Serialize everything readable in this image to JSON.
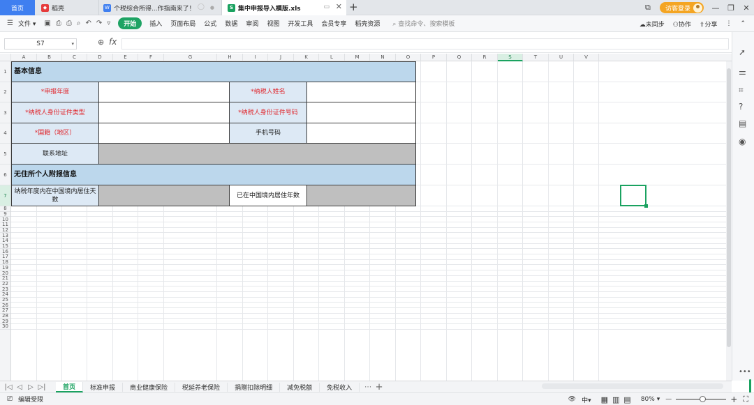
{
  "tabs": [
    {
      "label": "首页",
      "icon": "home"
    },
    {
      "label": "稻壳",
      "icon": "docer-icon",
      "icon_color": "#e63b3b"
    },
    {
      "label": "个税综合所得...作指南来了！",
      "icon": "writer-icon",
      "icon_color": "#3f7ff0"
    },
    {
      "label": "集中申报导入模版.xls",
      "icon": "sheet-icon",
      "icon_color": "#1aa260"
    }
  ],
  "window": {
    "login_label": "访客登录"
  },
  "toolbar": {
    "file": "文件",
    "start": "开始",
    "menus": [
      "插入",
      "页面布局",
      "公式",
      "数据",
      "审阅",
      "视图",
      "开发工具",
      "会员专享",
      "稻壳资源"
    ],
    "search_placeholder": "查找命令、搜索模板",
    "sync": "未同步",
    "collab": "协作",
    "share": "分享"
  },
  "formula_bar": {
    "cell_ref": "S7",
    "fx": "fx",
    "value": ""
  },
  "columns": [
    "A",
    "B",
    "C",
    "D",
    "E",
    "F",
    "G",
    "H",
    "I",
    "J",
    "K",
    "L",
    "M",
    "N",
    "O",
    "P",
    "Q",
    "R",
    "S",
    "T",
    "U",
    "V"
  ],
  "rows": [
    "1",
    "2",
    "3",
    "4",
    "5",
    "6",
    "7",
    "8",
    "9",
    "10",
    "11",
    "12",
    "13",
    "14",
    "15",
    "16",
    "17",
    "18",
    "19",
    "20",
    "21",
    "22",
    "23",
    "24",
    "25",
    "26",
    "27",
    "28",
    "29",
    "30"
  ],
  "form": {
    "section_basic": "基本信息",
    "tax_year": "*申报年度",
    "taxpayer_name": "*纳税人姓名",
    "id_type": "*纳税人身份证件类型",
    "id_number": "*纳税人身份证件号码",
    "nationality": "*国籍（地区）",
    "phone": "手机号码",
    "address": "联系地址",
    "section_nonresident": "无住所个人附报信息",
    "days_in_china": "纳税年度内在中国境内居住天数",
    "years_in_china": "已在中国境内居住年数"
  },
  "sheets": [
    "首页",
    "标准申报",
    "商业健康保险",
    "税延养老保险",
    "捐赠扣除明细",
    "减免税额",
    "免税收入"
  ],
  "status": {
    "mode": "编辑受限",
    "zoom": "80%"
  },
  "colors": {
    "accent": "#1aa260",
    "section_bg": "#bcd7ec",
    "label_bg": "#dde9f5",
    "required": "#e0282e",
    "filled_gray": "#bfbfbf"
  }
}
